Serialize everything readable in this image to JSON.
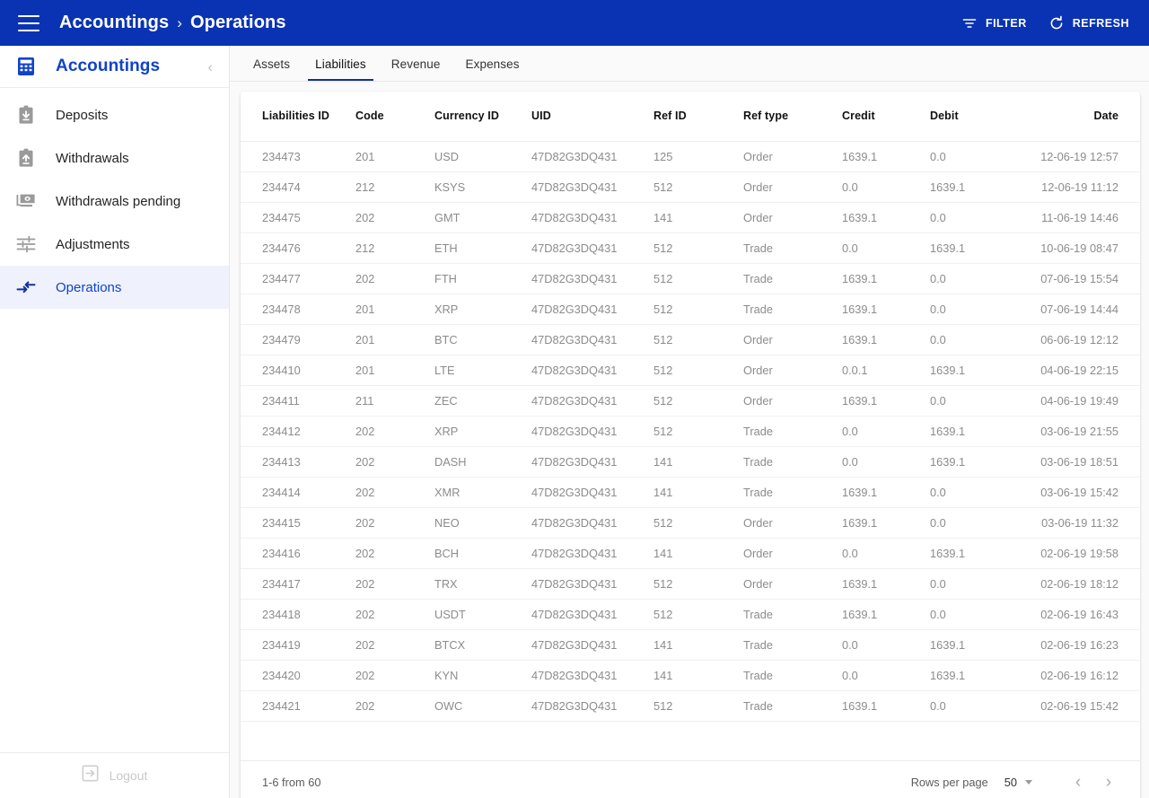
{
  "topbar": {
    "menu_icon": "hamburger-menu-icon",
    "breadcrumb": {
      "root": "Accountings",
      "separator": "›",
      "current": "Operations"
    },
    "filter_label": "FILTER",
    "refresh_label": "REFRESH",
    "background": "#0A33B3"
  },
  "sidebar": {
    "title": "Accountings",
    "title_icon": "calculator-icon",
    "collapse_icon": "chevron-left-icon",
    "accent": "#1142c9",
    "active_bg": "#eff2fd",
    "items": [
      {
        "label": "Deposits",
        "icon": "clipboard-download-icon",
        "active": false
      },
      {
        "label": "Withdrawals",
        "icon": "clipboard-upload-icon",
        "active": false
      },
      {
        "label": "Withdrawals pending",
        "icon": "banknotes-icon",
        "active": false
      },
      {
        "label": "Adjustments",
        "icon": "sliders-tune-icon",
        "active": false
      },
      {
        "label": "Operations",
        "icon": "compare-arrows-icon",
        "active": true
      }
    ],
    "logout": {
      "label": "Logout",
      "icon": "logout-icon"
    }
  },
  "main": {
    "tabs": [
      {
        "label": "Assets",
        "active": false
      },
      {
        "label": "Liabilities",
        "active": true
      },
      {
        "label": "Revenue",
        "active": false
      },
      {
        "label": "Expenses",
        "active": false
      }
    ],
    "table": {
      "columns": [
        "Liabilities ID",
        "Code",
        "Currency ID",
        "UID",
        "Ref ID",
        "Ref type",
        "Credit",
        "Debit",
        "Date"
      ],
      "rows": [
        [
          "234473",
          "201",
          "USD",
          "47D82G3DQ431",
          "125",
          "Order",
          "1639.1",
          "0.0",
          "12-06-19 12:57"
        ],
        [
          "234474",
          "212",
          "KSYS",
          "47D82G3DQ431",
          "512",
          "Order",
          "0.0",
          "1639.1",
          "12-06-19 11:12"
        ],
        [
          "234475",
          "202",
          "GMT",
          "47D82G3DQ431",
          "141",
          "Order",
          "1639.1",
          "0.0",
          "11-06-19 14:46"
        ],
        [
          "234476",
          "212",
          "ETH",
          "47D82G3DQ431",
          "512",
          "Trade",
          "0.0",
          "1639.1",
          "10-06-19 08:47"
        ],
        [
          "234477",
          "202",
          "FTH",
          "47D82G3DQ431",
          "512",
          "Trade",
          "1639.1",
          "0.0",
          "07-06-19 15:54"
        ],
        [
          "234478",
          "201",
          "XRP",
          "47D82G3DQ431",
          "512",
          "Trade",
          "1639.1",
          "0.0",
          "07-06-19 14:44"
        ],
        [
          "234479",
          "201",
          "BTC",
          "47D82G3DQ431",
          "512",
          "Order",
          "1639.1",
          "0.0",
          "06-06-19 12:12"
        ],
        [
          "234410",
          "201",
          "LTE",
          "47D82G3DQ431",
          "512",
          "Order",
          "0.0.1",
          "1639.1",
          "04-06-19 22:15"
        ],
        [
          "234411",
          "211",
          "ZEC",
          "47D82G3DQ431",
          "512",
          "Order",
          "1639.1",
          "0.0",
          "04-06-19 19:49"
        ],
        [
          "234412",
          "202",
          "XRP",
          "47D82G3DQ431",
          "512",
          "Trade",
          "0.0",
          "1639.1",
          "03-06-19 21:55"
        ],
        [
          "234413",
          "202",
          "DASH",
          "47D82G3DQ431",
          "141",
          "Trade",
          "0.0",
          "1639.1",
          "03-06-19 18:51"
        ],
        [
          "234414",
          "202",
          "XMR",
          "47D82G3DQ431",
          "141",
          "Trade",
          "1639.1",
          "0.0",
          "03-06-19 15:42"
        ],
        [
          "234415",
          "202",
          "NEO",
          "47D82G3DQ431",
          "512",
          "Order",
          "1639.1",
          "0.0",
          "03-06-19 11:32"
        ],
        [
          "234416",
          "202",
          "BCH",
          "47D82G3DQ431",
          "141",
          "Order",
          "0.0",
          "1639.1",
          "02-06-19 19:58"
        ],
        [
          "234417",
          "202",
          "TRX",
          "47D82G3DQ431",
          "512",
          "Order",
          "1639.1",
          "0.0",
          "02-06-19 18:12"
        ],
        [
          "234418",
          "202",
          "USDT",
          "47D82G3DQ431",
          "512",
          "Trade",
          "1639.1",
          "0.0",
          "02-06-19 16:43"
        ],
        [
          "234419",
          "202",
          "BTCX",
          "47D82G3DQ431",
          "141",
          "Trade",
          "0.0",
          "1639.1",
          "02-06-19 16:23"
        ],
        [
          "234420",
          "202",
          "KYN",
          "47D82G3DQ431",
          "141",
          "Trade",
          "0.0",
          "1639.1",
          "02-06-19 16:12"
        ],
        [
          "234421",
          "202",
          "OWC",
          "47D82G3DQ431",
          "512",
          "Trade",
          "1639.1",
          "0.0",
          "02-06-19 15:42"
        ]
      ]
    },
    "footer": {
      "range": "1-6 from 60",
      "rows_per_page_label": "Rows per page",
      "rows_per_page_value": "50",
      "prev_icon": "chevron-left-icon",
      "next_icon": "chevron-right-icon"
    }
  }
}
